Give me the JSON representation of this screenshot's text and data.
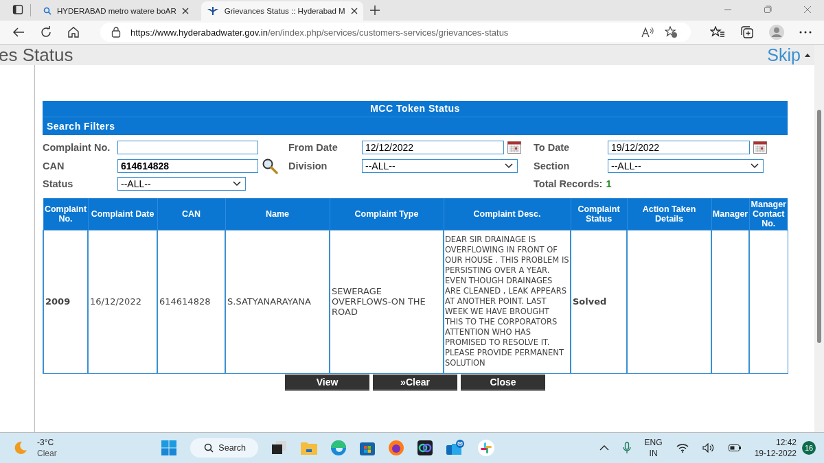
{
  "browser": {
    "tabs": [
      {
        "title": "HYDERABAD metro watere boAR",
        "selected": false
      },
      {
        "title": "Grievances Status :: Hyderabad M",
        "selected": true
      }
    ],
    "url_host": "https://www.hyderabadwater.gov.in",
    "url_path": "/en/index.php/services/customers-services/grievances-status"
  },
  "page": {
    "heading": "es Status",
    "skip_link": "Skip"
  },
  "panel": {
    "title": "MCC Token Status",
    "filters_title": "Search Filters",
    "filters": [
      {
        "label": "Complaint No.",
        "kind": "text"
      },
      {
        "label": "From Date",
        "kind": "date",
        "value": "12/12/2022"
      },
      {
        "label": "To Date",
        "kind": "date",
        "value": "19/12/2022"
      },
      {
        "label": "CAN",
        "kind": "search",
        "value": "614614828"
      },
      {
        "label": "Division",
        "kind": "select",
        "value": "--ALL--"
      },
      {
        "label": "Section",
        "kind": "select",
        "value": "--ALL--"
      },
      {
        "label": "Status",
        "kind": "select",
        "value": "--ALL--"
      },
      {
        "label": "Total Records:",
        "kind": "total",
        "value": "1"
      }
    ],
    "table": {
      "columns": [
        {
          "label": "Complaint No.",
          "bold": true
        },
        {
          "label": "Complaint Date",
          "bold": false
        },
        {
          "label": "CAN",
          "bold": false
        },
        {
          "label": "Name",
          "bold": false
        },
        {
          "label": "Complaint Type",
          "bold": false
        },
        {
          "label": "Complaint Desc.",
          "bold": false
        },
        {
          "label": "Complaint Status",
          "bold": true
        },
        {
          "label": "Action Taken Details",
          "bold": false
        },
        {
          "label": "Manager",
          "bold": false
        },
        {
          "label": "Manager Contact No.",
          "bold": false
        }
      ],
      "rows": [
        {
          "cells": [
            "2009",
            "16/12/2022",
            "614614828",
            "S.SATYANARAYANA",
            "SEWERAGE OVERFLOWS-ON THE ROAD",
            "DEAR SIR DRAINAGE IS OVERFLOWING IN FRONT OF OUR HOUSE . THIS PROBLEM IS PERSISTING OVER A YEAR. EVEN THOUGH DRAINAGES ARE CLEANED , LEAK APPEARS AT ANOTHER POINT. LAST WEEK WE HAVE BROUGHT THIS TO THE CORPORATORS ATTENTION WHO HAS PROMISED TO RESOLVE IT. PLEASE PROVIDE PERMANENT SOLUTION",
            "Solved"
          ]
        }
      ]
    },
    "buttons": [
      "View",
      "»Clear",
      "Close"
    ]
  },
  "taskbar": {
    "weather_temp": "-3°C",
    "weather_text": "Clear",
    "search": "Search",
    "lang": "ENG",
    "region": "IN",
    "time": "12:42",
    "date": "19-12-2022",
    "notifications": "16"
  }
}
